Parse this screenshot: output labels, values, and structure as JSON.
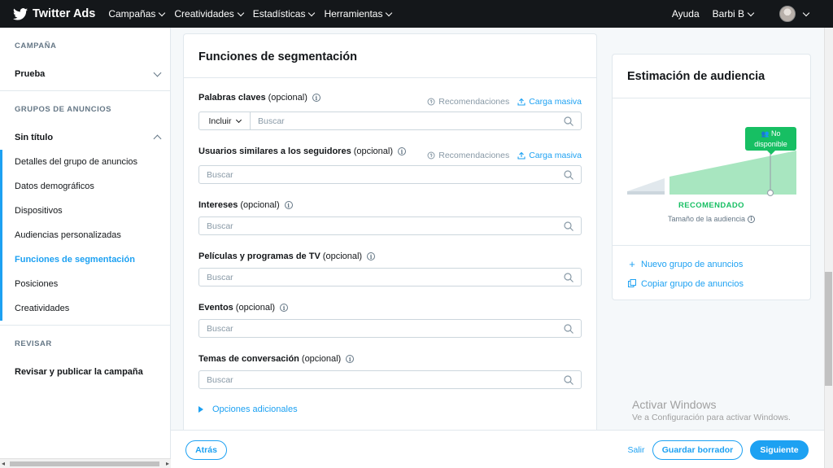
{
  "topbar": {
    "brand": "Twitter Ads",
    "menu": [
      "Campañas",
      "Creatividades",
      "Estadísticas",
      "Herramientas"
    ],
    "help": "Ayuda",
    "user": "Barbi B"
  },
  "sidebar": {
    "campaign_header": "CAMPAÑA",
    "campaign_name": "Prueba",
    "groups_header": "GRUPOS DE ANUNCIOS",
    "group_name": "Sin título",
    "items": [
      "Detalles del grupo de anuncios",
      "Datos demográficos",
      "Dispositivos",
      "Audiencias personalizadas",
      "Funciones de segmentación",
      "Posiciones",
      "Creatividades"
    ],
    "active_item": "Funciones de segmentación",
    "review_header": "REVISAR",
    "review_item": "Revisar y publicar la campaña"
  },
  "form": {
    "title": "Funciones de segmentación",
    "recommendations": "Recomendaciones",
    "bulk_upload": "Carga masiva",
    "include_label": "Incluir",
    "search_placeholder": "Buscar",
    "fields": [
      {
        "label": "Palabras claves",
        "optional": "(opcional)"
      },
      {
        "label": "Usuarios similares a los seguidores",
        "optional": "(opcional)"
      },
      {
        "label": "Intereses",
        "optional": "(opcional)"
      },
      {
        "label": "Películas y programas de TV",
        "optional": "(opcional)"
      },
      {
        "label": "Eventos",
        "optional": "(opcional)"
      },
      {
        "label": "Temas de conversación",
        "optional": "(opcional)"
      }
    ],
    "more_options": "Opciones adicionales"
  },
  "audience": {
    "title": "Estimación de audiencia",
    "tooltip_line1": "No",
    "tooltip_line2": "disponible",
    "recommended": "RECOMENDADO",
    "size_label": "Tamaño de la audiencia",
    "new_group": "Nuevo grupo de anuncios",
    "copy_group": "Copiar grupo de anuncios"
  },
  "watermark": {
    "line1": "Activar Windows",
    "line2": "Ve a Configuración para activar Windows."
  },
  "footer": {
    "back": "Atrás",
    "exit": "Salir",
    "save_draft": "Guardar borrador",
    "next": "Siguiente"
  },
  "colors": {
    "accent": "#1da1f2",
    "recommended_green": "#17bf63",
    "topbar": "#14171a"
  }
}
